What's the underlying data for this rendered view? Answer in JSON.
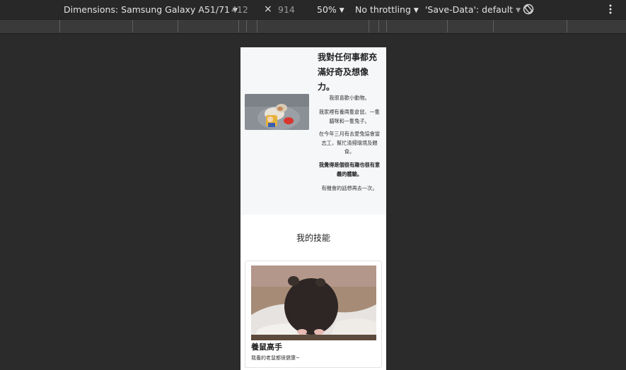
{
  "toolbar": {
    "device_label": "Dimensions: Samsung Galaxy A51/71",
    "width_value": "412",
    "times": "×",
    "height_value": "914",
    "zoom": "50%",
    "throttling": "No throttling",
    "save_data": "'Save-Data': default",
    "rotate_icon": "rotate-icon",
    "more_icon": "kebab-menu-icon"
  },
  "page": {
    "about": {
      "title": "我對任何事都充滿好奇及想像力。",
      "paragraphs": [
        "我很喜歡小動物。",
        "我家裡有養兩隻倉鼠、一隻貓咪和一隻兔子。",
        "在今年三月有去愛兔協會當志工，幫忙清掃環境及餵食。",
        "我覺得是個很有趣也很有意義的體驗。",
        "有機會的話想再去一次。"
      ],
      "image": "cat-with-toy"
    },
    "skills": {
      "title": "我的技能",
      "cards": [
        {
          "title": "養鼠高手",
          "text": "我養的老鼠都很健康~",
          "image": "hamster"
        }
      ]
    }
  },
  "colors": {
    "devtools_bg": "#2b2b2b",
    "toolbar_bg": "#282828",
    "about_bg": "#f6f7f9"
  }
}
